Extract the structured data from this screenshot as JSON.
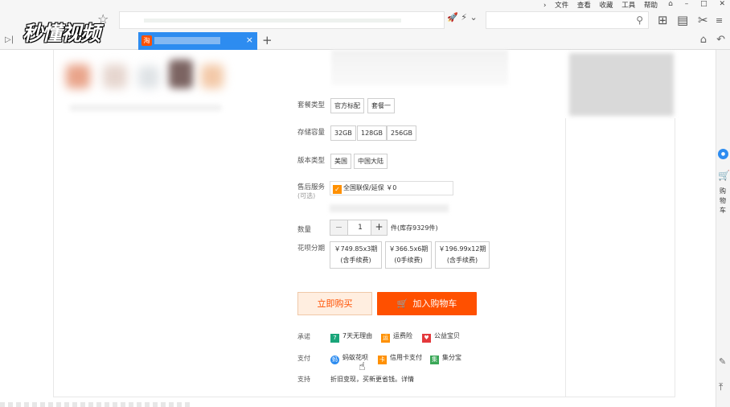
{
  "watermark": "秒懂视频",
  "menu": [
    "文件",
    "查看",
    "收藏",
    "工具",
    "帮助"
  ],
  "window_controls": [
    "⌂",
    "–",
    "□",
    "✕"
  ],
  "tab": {
    "icon_text": "淘"
  },
  "product": {
    "package_type": {
      "label": "套餐类型",
      "options": [
        "官方标配",
        "套餐一"
      ]
    },
    "storage": {
      "label": "存储容量",
      "options": [
        "32GB",
        "128GB",
        "256GB"
      ]
    },
    "version": {
      "label": "版本类型",
      "options": [
        "美国",
        "中国大陆"
      ]
    },
    "service": {
      "label": "售后服务",
      "sub_label": "(可选)",
      "option": "全国联保/延保 ￥0"
    },
    "quantity": {
      "label": "数量",
      "minus": "−",
      "value": "1",
      "plus": "+",
      "stock": "件(库存9329件)"
    },
    "installment": {
      "label": "花呗分期",
      "options": [
        {
          "line1": "￥749.85x3期",
          "line2": "(含手续费)"
        },
        {
          "line1": "￥366.5x6期",
          "line2": "(0手续费)"
        },
        {
          "line1": "￥196.99x12期",
          "line2": "(含手续费)"
        }
      ]
    },
    "buy_now": "立即购买",
    "add_to_cart": "加入购物车"
  },
  "promises": {
    "label": "承诺",
    "items": [
      {
        "icon": "7",
        "text": "7天无理由",
        "color": "#1aa57a"
      },
      {
        "icon": "运",
        "text": "运费险",
        "color": "#ff9000"
      },
      {
        "icon": "♥",
        "text": "公益宝贝",
        "color": "#e4393c"
      }
    ]
  },
  "payment": {
    "label": "支付",
    "items": [
      {
        "icon": "蚂",
        "text": "蚂蚁花呗",
        "color": "#2d8cf0"
      },
      {
        "icon": "卡",
        "text": "信用卡支付",
        "color": "#ff9000"
      },
      {
        "icon": "集",
        "text": "集分宝",
        "color": "#3aa757"
      }
    ]
  },
  "support": {
    "label": "支持",
    "text": "折旧变现，买新更省钱。详情"
  },
  "sidebar": {
    "cart_label": "购物车"
  }
}
